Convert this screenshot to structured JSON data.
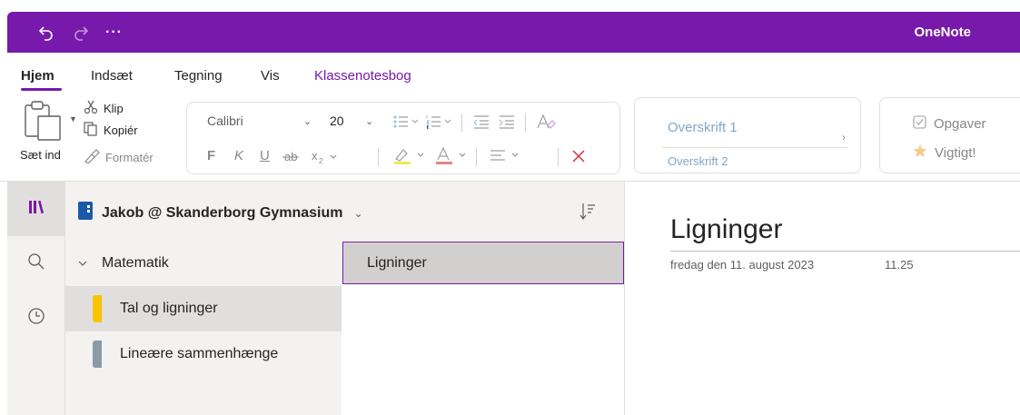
{
  "app": {
    "name": "OneNote",
    "more": "···"
  },
  "tabs": [
    {
      "label": "Hjem"
    },
    {
      "label": "Indsæt"
    },
    {
      "label": "Tegning"
    },
    {
      "label": "Vis"
    },
    {
      "label": "Klassenotesbog"
    }
  ],
  "clipboard": {
    "paste": "Sæt ind",
    "cut": "Klip",
    "copy": "Kopiér",
    "format": "Formatér"
  },
  "font": {
    "name": "Calibri",
    "size": "20",
    "bold": "F",
    "italic": "K",
    "underline": "U"
  },
  "styles": {
    "heading1": "Overskrift 1",
    "heading2": "Overskrift 2"
  },
  "tags": {
    "todo": "Opgaver",
    "important": "Vigtigt!"
  },
  "notebook": {
    "title": "Jakob @ Skanderborg Gymnasium"
  },
  "section_group": {
    "label": "Matematik"
  },
  "sections": [
    {
      "label": "Tal og ligninger",
      "color": "#f8c400"
    },
    {
      "label": "Lineære sammenhænge",
      "color": "#8a9ba7"
    }
  ],
  "pages": [
    {
      "label": "Ligninger"
    }
  ],
  "page": {
    "title": "Ligninger",
    "date": "fredag den 11. august 2023",
    "time": "11.25"
  },
  "colors": {
    "accent": "#7719aa",
    "heading": "#7ea7c9",
    "notebook_icon": "#1b5aa6"
  }
}
